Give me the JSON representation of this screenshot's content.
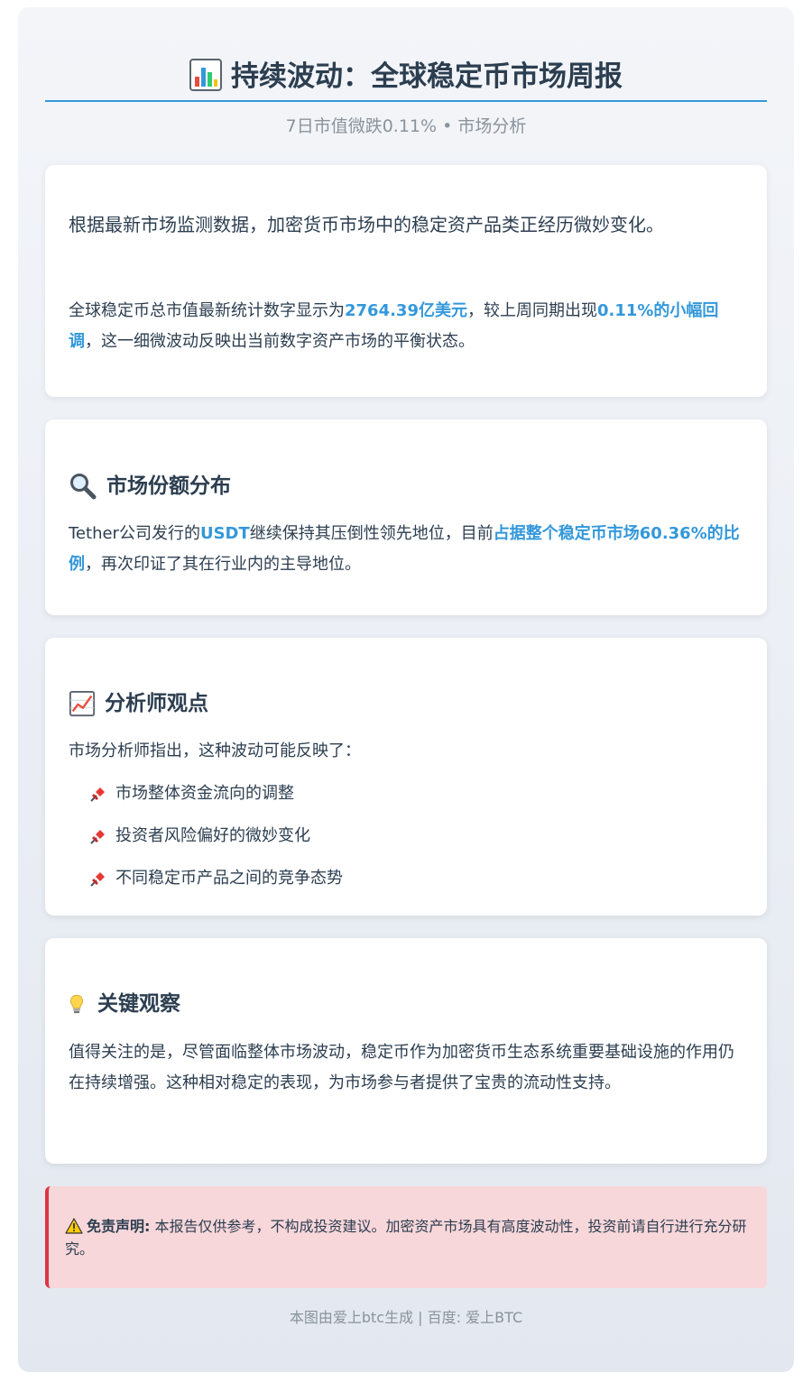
{
  "header": {
    "title": "持续波动：全球稳定币市场周报",
    "title_icon": "bar-chart-icon",
    "subtitle": "7日市值微跌0.11% • 市场分析"
  },
  "intro_card": {
    "lead": "根据最新市场监测数据，加密货币市场中的稳定资产品类正经历微妙变化。",
    "p_before": "全球稳定币总市值最新统计数字显示为",
    "p_value": "2764.39亿美元",
    "p_middle": "，较上周同期出现",
    "p_change": "0.11%的小幅回调",
    "p_after": "，这一细微波动反映出当前数字资产市场的平衡状态。"
  },
  "market_share": {
    "heading": "市场份额分布",
    "icon": "magnifier-icon",
    "p_before": "Tether公司发行的",
    "p_usdt": "USDT",
    "p_middle": "继续保持其压倒性领先地位，目前",
    "p_share": "占据整个稳定币市场60.36%的比例",
    "p_after": "，再次印证了其在行业内的主导地位。"
  },
  "analyst_view": {
    "heading": "分析师观点",
    "icon": "chart-increasing-icon",
    "intro": "市场分析师指出，这种波动可能反映了：",
    "items": [
      "市场整体资金流向的调整",
      "投资者风险偏好的微妙变化",
      "不同稳定币产品之间的竞争态势"
    ],
    "item_icon": "pushpin-icon"
  },
  "key_observation": {
    "heading": "关键观察",
    "icon": "light-bulb-icon",
    "text": "值得关注的是，尽管面临整体市场波动，稳定币作为加密货币生态系统重要基础设施的作用仍在持续增强。这种相对稳定的表现，为市场参与者提供了宝贵的流动性支持。"
  },
  "disclaimer": {
    "icon": "warning-icon",
    "label": "免责声明:",
    "text": "本报告仅供参考，不构成投资建议。加密资产市场具有高度波动性，投资前请自行进行充分研究。"
  },
  "footer": {
    "text": "本图由爱上btc生成 | 百度: 爱上BTC"
  },
  "colors": {
    "accent": "#3498db",
    "text": "#2c3e50",
    "muted": "#8a939c",
    "disclaimer_bg": "#f8d7da",
    "disclaimer_border": "#dc3545"
  }
}
